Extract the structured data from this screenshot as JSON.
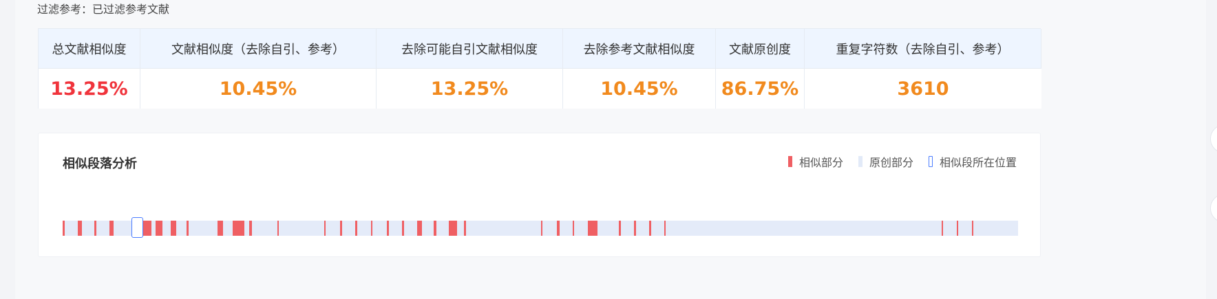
{
  "filter_note": "过滤参考：已过滤参考文献",
  "stats": {
    "headers": [
      "总文献相似度",
      "文献相似度（去除自引、参考）",
      "去除可能自引文献相似度",
      "去除参考文献相似度",
      "文献原创度",
      "重复字符数（去除自引、参考）"
    ],
    "values": [
      "13.25%",
      "10.45%",
      "13.25%",
      "10.45%",
      "86.75%",
      "3610"
    ],
    "value_colors": [
      "#f0343c",
      "#f18a1e",
      "#f18a1e",
      "#f18a1e",
      "#f18a1e",
      "#f18a1e"
    ]
  },
  "panel": {
    "title": "相似段落分析",
    "legend": {
      "similar": "相似部分",
      "original": "原创部分",
      "position": "相似段所在位置"
    },
    "colors": {
      "similar": "#ef5f63",
      "original": "#e4ebf9",
      "position_marker": "#4a7cff"
    },
    "current_position_fraction": 0.072,
    "similar_segments": [
      [
        0.0,
        0.002
      ],
      [
        0.016,
        0.02
      ],
      [
        0.033,
        0.035
      ],
      [
        0.049,
        0.053
      ],
      [
        0.081,
        0.093
      ],
      [
        0.097,
        0.104
      ],
      [
        0.113,
        0.119
      ],
      [
        0.13,
        0.132
      ],
      [
        0.162,
        0.168
      ],
      [
        0.178,
        0.19
      ],
      [
        0.195,
        0.198
      ],
      [
        0.225,
        0.226
      ],
      [
        0.274,
        0.275
      ],
      [
        0.29,
        0.292
      ],
      [
        0.306,
        0.308
      ],
      [
        0.323,
        0.324
      ],
      [
        0.339,
        0.341
      ],
      [
        0.355,
        0.357
      ],
      [
        0.371,
        0.376
      ],
      [
        0.388,
        0.391
      ],
      [
        0.404,
        0.413
      ],
      [
        0.42,
        0.422
      ],
      [
        0.501,
        0.502
      ],
      [
        0.517,
        0.52
      ],
      [
        0.534,
        0.535
      ],
      [
        0.55,
        0.56
      ],
      [
        0.582,
        0.584
      ],
      [
        0.598,
        0.6
      ],
      [
        0.614,
        0.616
      ],
      [
        0.63,
        0.631
      ],
      [
        0.92,
        0.921
      ],
      [
        0.936,
        0.937
      ],
      [
        0.952,
        0.953
      ]
    ]
  }
}
